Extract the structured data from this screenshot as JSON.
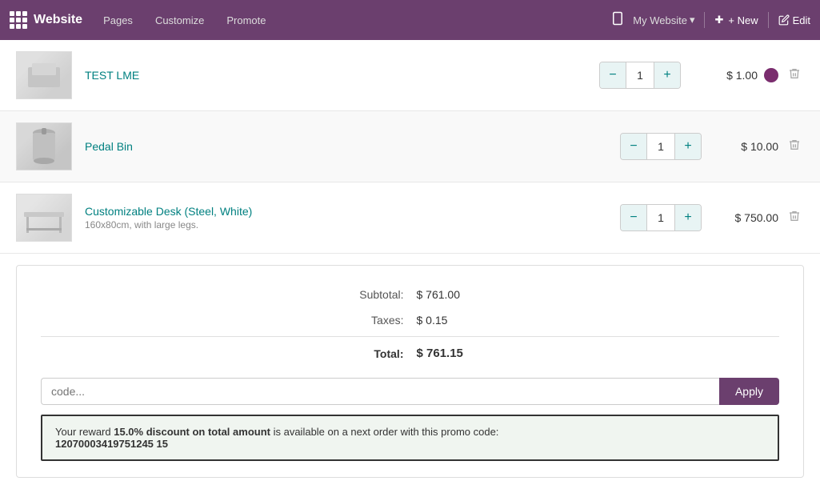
{
  "topnav": {
    "logo_label": "Website",
    "links": [
      "Pages",
      "Customize",
      "Promote"
    ],
    "mysite_label": "My Website",
    "new_label": "+ New",
    "edit_label": "Edit"
  },
  "cart": {
    "items": [
      {
        "id": "test-lme",
        "name": "TEST LME",
        "sub": "",
        "qty": 1,
        "price": "$ 1.00",
        "has_color": true
      },
      {
        "id": "pedal-bin",
        "name": "Pedal Bin",
        "sub": "",
        "qty": 1,
        "price": "$ 10.00",
        "has_color": false
      },
      {
        "id": "customizable-desk",
        "name": "Customizable Desk (Steel, White)",
        "sub": "160x80cm, with large legs.",
        "qty": 1,
        "price": "$ 750.00",
        "has_color": false
      }
    ]
  },
  "summary": {
    "subtotal_label": "Subtotal:",
    "subtotal_value": "$ 761.00",
    "taxes_label": "Taxes:",
    "taxes_value": "$ 0.15",
    "total_label": "Total:",
    "total_value": "$ 761.15"
  },
  "promo": {
    "placeholder": "code...",
    "apply_label": "Apply"
  },
  "reward": {
    "prefix": "Your reward ",
    "highlight": "15.0% discount on total amount",
    "suffix": " is available on a next order with this promo code:",
    "code": "12070003419751245 15"
  }
}
